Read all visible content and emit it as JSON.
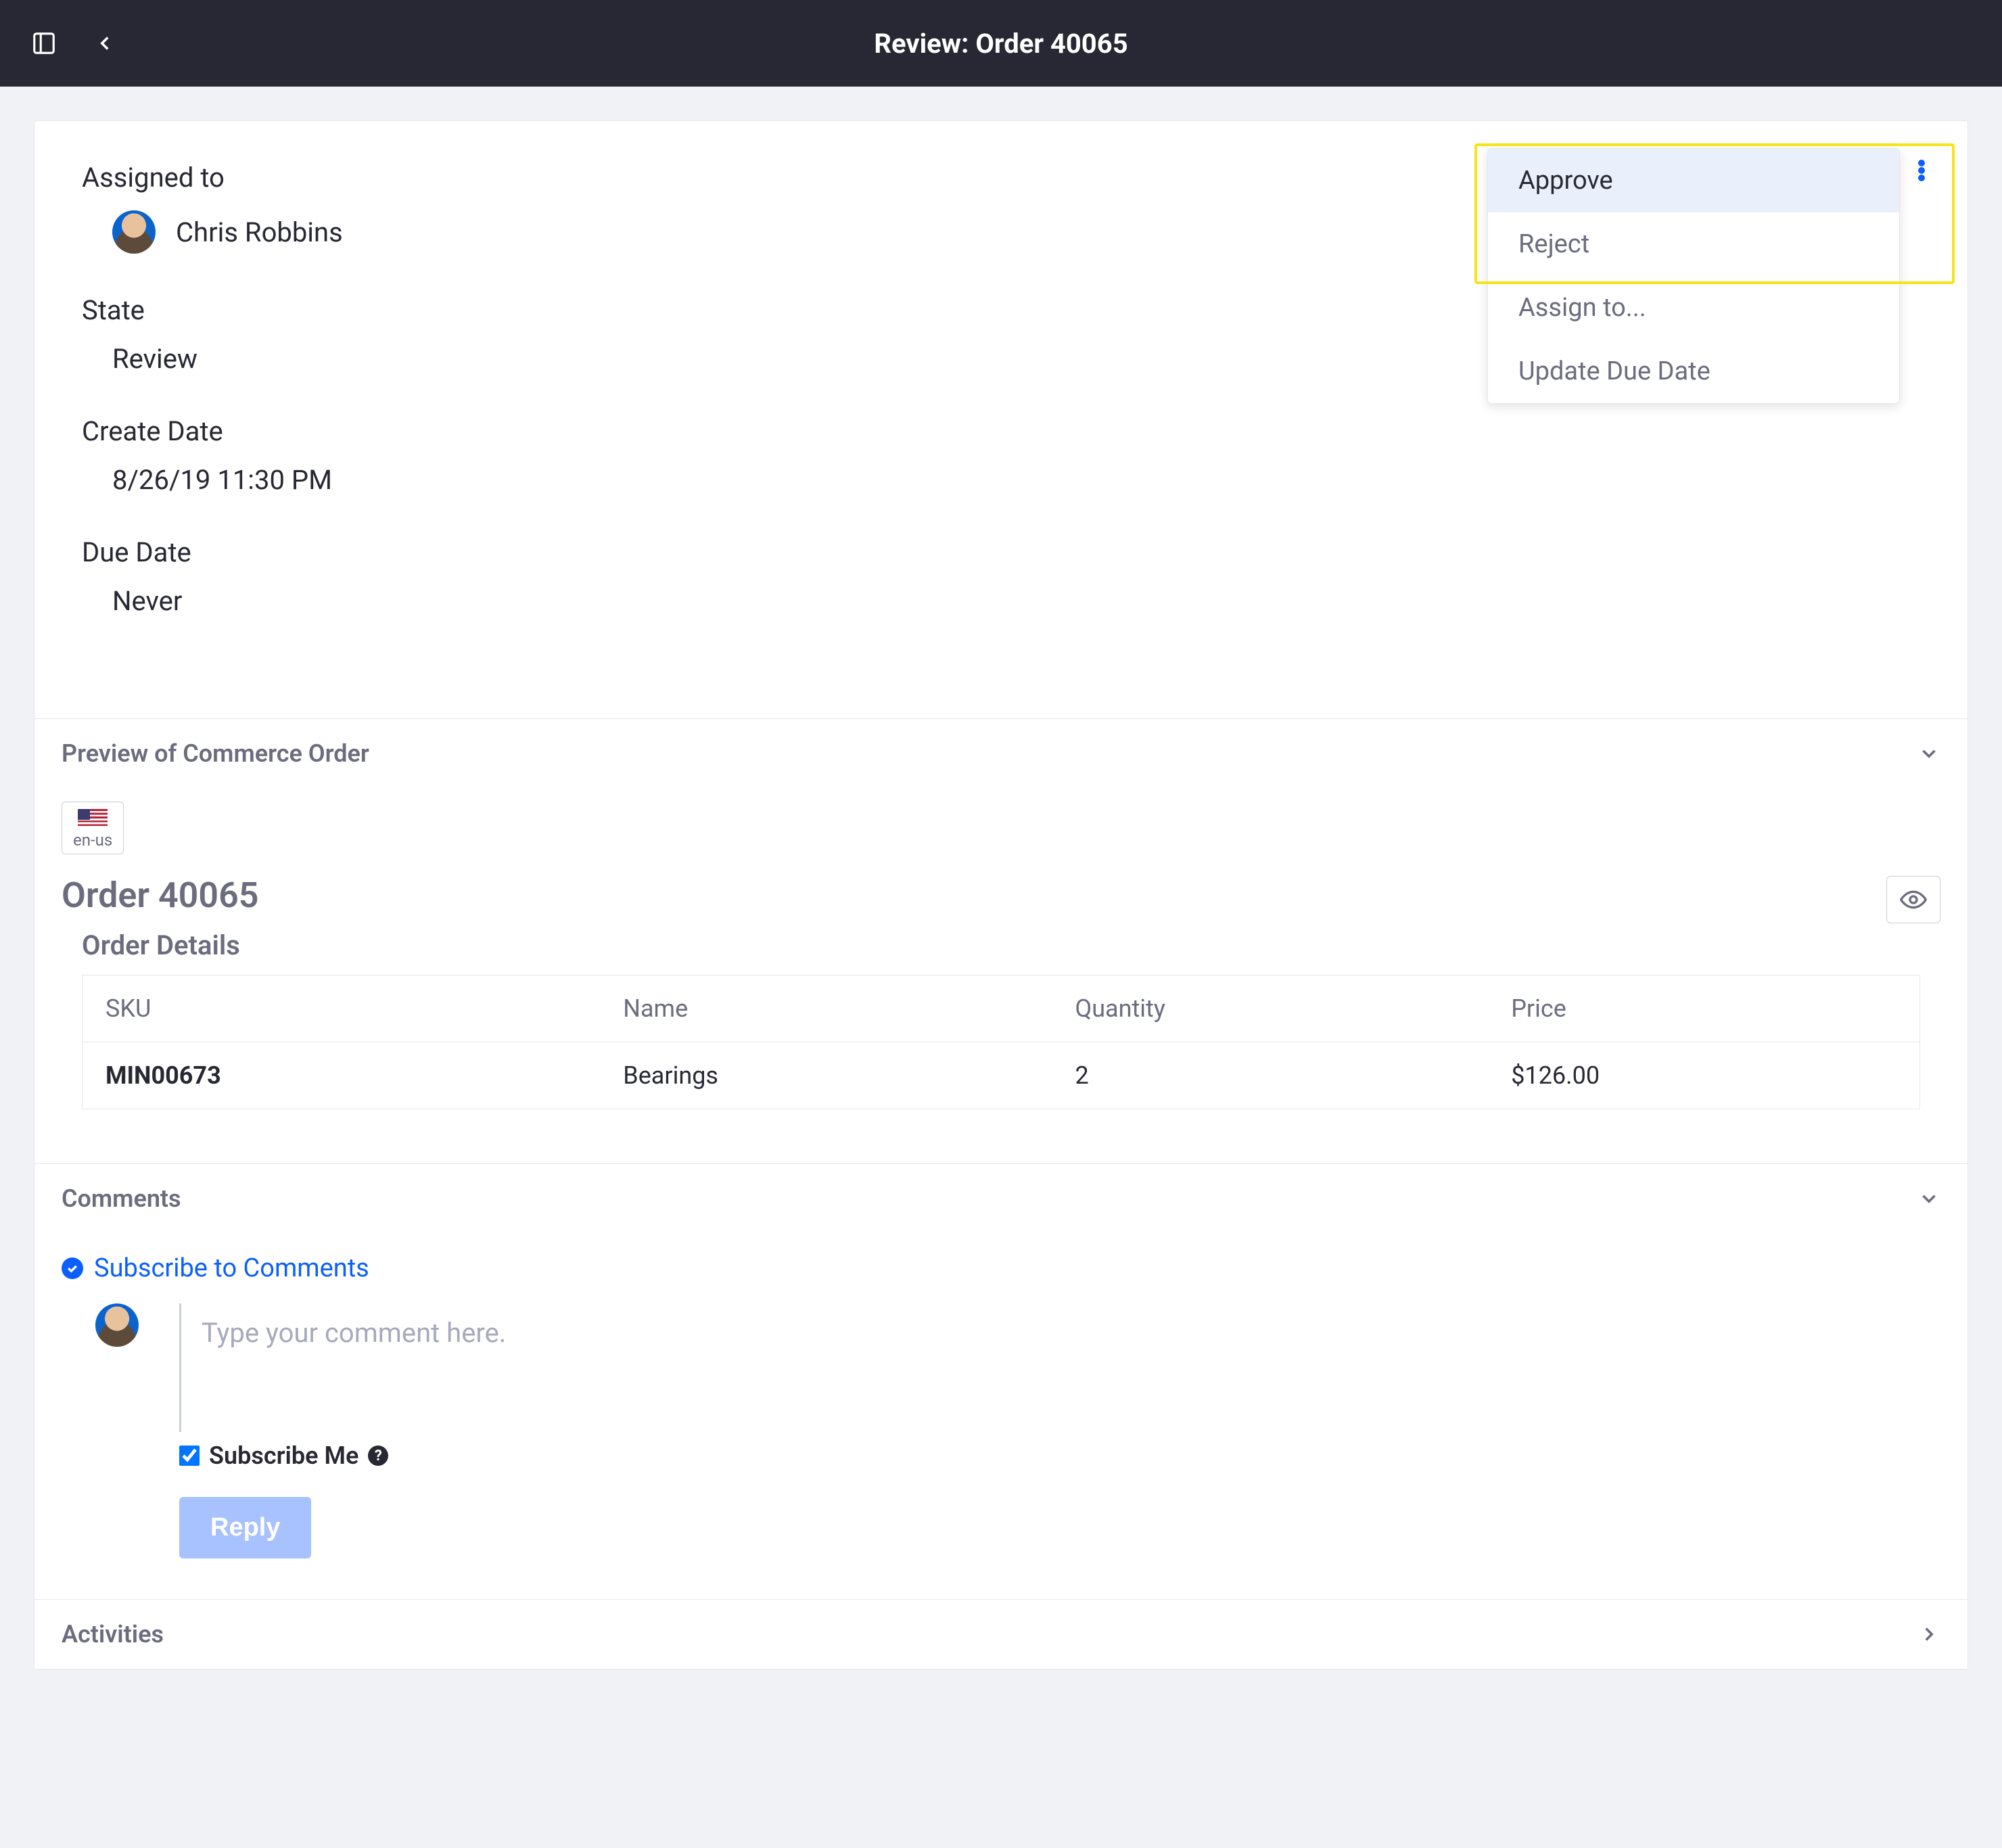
{
  "header": {
    "title": "Review: Order 40065"
  },
  "details": {
    "assigned_label": "Assigned to",
    "assigned_user": "Chris Robbins",
    "state_label": "State",
    "state_value": "Review",
    "create_date_label": "Create Date",
    "create_date_value": "8/26/19 11:30 PM",
    "due_date_label": "Due Date",
    "due_date_value": "Never"
  },
  "actions": {
    "items": [
      "Approve",
      "Reject",
      "Assign to...",
      "Update Due Date"
    ]
  },
  "preview": {
    "section_title": "Preview of Commerce Order",
    "locale": "en-us",
    "order_title": "Order 40065",
    "details_title": "Order Details",
    "columns": {
      "sku": "SKU",
      "name": "Name",
      "qty": "Quantity",
      "price": "Price"
    },
    "rows": [
      {
        "sku": "MIN00673",
        "name": "Bearings",
        "qty": "2",
        "price": "$126.00"
      }
    ]
  },
  "comments": {
    "section_title": "Comments",
    "subscribe_link": "Subscribe to Comments",
    "placeholder": "Type your comment here.",
    "subscribe_me_label": "Subscribe Me",
    "reply_label": "Reply"
  },
  "activities": {
    "section_title": "Activities"
  }
}
